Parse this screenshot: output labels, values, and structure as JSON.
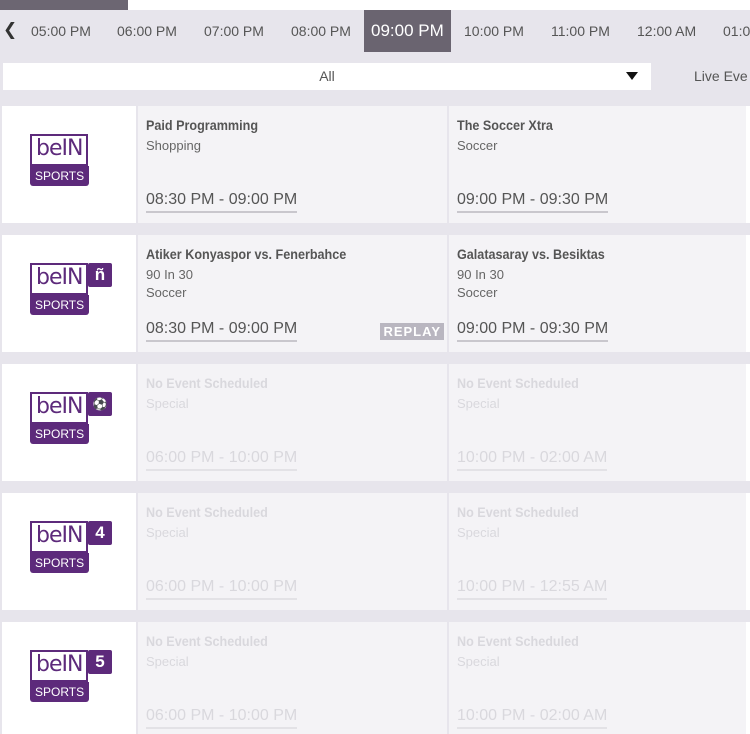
{
  "timebar": {
    "prev_icon": "chevron-left-icon",
    "prev_glyph": "❮",
    "slots": [
      "05:00 PM",
      "06:00 PM",
      "07:00 PM",
      "08:00 PM",
      "09:00 PM",
      "10:00 PM",
      "11:00 PM",
      "12:00 AM",
      "01:0"
    ],
    "active_index": 4
  },
  "filter": {
    "selected": "All",
    "live_tab": "Live Eve"
  },
  "colors": {
    "brand": "#5d2a7b",
    "active_slot": "#6a6470"
  },
  "channels": [
    {
      "logo": {
        "word": "beIN",
        "sports": "SPORTS",
        "badge": ""
      },
      "programs": [
        {
          "title": "Paid Programming",
          "sub1": "Shopping",
          "sub2": "",
          "time": "08:30 PM - 09:00 PM",
          "replay": "",
          "dim": false
        },
        {
          "title": "The Soccer Xtra",
          "sub1": "Soccer",
          "sub2": "",
          "time": "09:00 PM - 09:30 PM",
          "replay": "",
          "dim": false
        }
      ]
    },
    {
      "logo": {
        "word": "beIN",
        "sports": "SPORTS",
        "badge": "ñ"
      },
      "programs": [
        {
          "title": "Atiker Konyaspor vs. Fenerbahce",
          "sub1": "90 In 30",
          "sub2": "Soccer",
          "time": "08:30 PM - 09:00 PM",
          "replay": "REPLAY",
          "dim": false
        },
        {
          "title": "Galatasaray vs. Besiktas",
          "sub1": "90 In 30",
          "sub2": "Soccer",
          "time": "09:00 PM - 09:30 PM",
          "replay": "",
          "dim": false
        }
      ]
    },
    {
      "logo": {
        "word": "beIN",
        "sports": "SPORTS",
        "badge": "⚽"
      },
      "programs": [
        {
          "title": "No Event Scheduled",
          "sub1": "Special",
          "sub2": "",
          "time": "06:00 PM - 10:00 PM",
          "replay": "",
          "dim": true
        },
        {
          "title": "No Event Scheduled",
          "sub1": "Special",
          "sub2": "",
          "time": "10:00 PM - 02:00 AM",
          "replay": "",
          "dim": true
        }
      ]
    },
    {
      "logo": {
        "word": "beIN",
        "sports": "SPORTS",
        "badge": "4"
      },
      "programs": [
        {
          "title": "No Event Scheduled",
          "sub1": "Special",
          "sub2": "",
          "time": "06:00 PM - 10:00 PM",
          "replay": "",
          "dim": true
        },
        {
          "title": "No Event Scheduled",
          "sub1": "Special",
          "sub2": "",
          "time": "10:00 PM - 12:55 AM",
          "replay": "",
          "dim": true
        }
      ]
    },
    {
      "logo": {
        "word": "beIN",
        "sports": "SPORTS",
        "badge": "5"
      },
      "programs": [
        {
          "title": "No Event Scheduled",
          "sub1": "Special",
          "sub2": "",
          "time": "06:00 PM - 10:00 PM",
          "replay": "",
          "dim": true
        },
        {
          "title": "No Event Scheduled",
          "sub1": "Special",
          "sub2": "",
          "time": "10:00 PM - 02:00 AM",
          "replay": "",
          "dim": true
        }
      ]
    }
  ]
}
